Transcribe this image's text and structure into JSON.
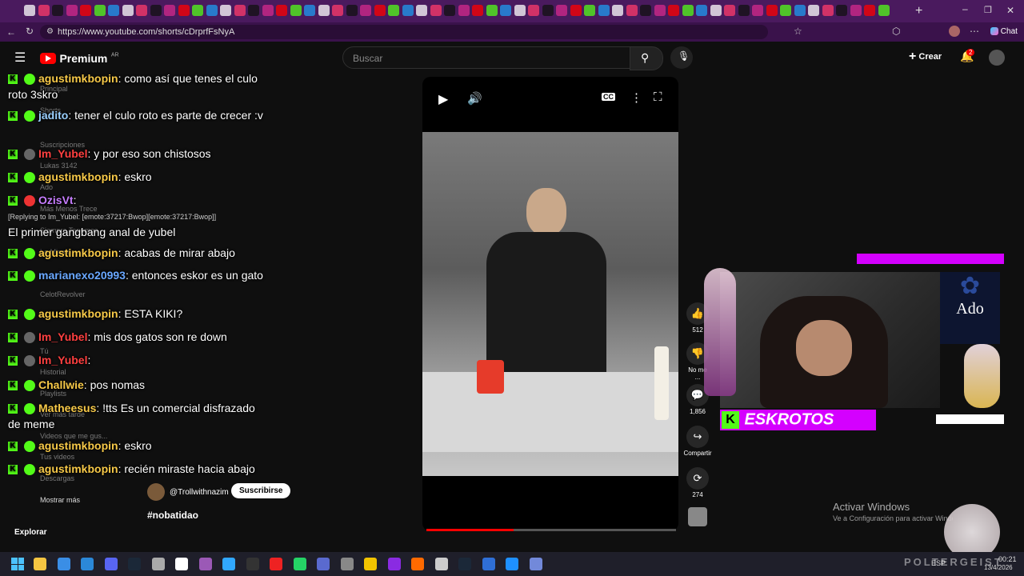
{
  "browser": {
    "url": "https://www.youtube.com/shorts/cDrprfFsNyA",
    "chat_label": "Chat"
  },
  "header": {
    "logo_text": "Premium",
    "region": "AR",
    "search_placeholder": "Buscar",
    "create_label": "Crear",
    "notif_count": "2"
  },
  "sidebar": {
    "items": [
      "Principal",
      "Shorts",
      "Suscripciones",
      "Lukas 3142",
      "Ado",
      "Más Menos Trece",
      "Siempre Tenemos",
      "Lo Mismo",
      "CelotRevolver",
      "Tú",
      "Historial",
      "Playlists",
      "Ver más tarde",
      "Videos que me gus...",
      "Tus videos",
      "Descargas",
      "Mostrar más"
    ],
    "explore_label": "Explorar"
  },
  "chat": [
    {
      "user": "agustimkbopin",
      "text": "como así que tenes el culo roto 3skro",
      "color": "g"
    },
    {
      "user": "jadito",
      "text": "tener el culo roto es parte de crecer :v",
      "color": "b"
    },
    {
      "user": "Im_Yubel",
      "text": "y por eso son chistosos",
      "color": "r"
    },
    {
      "user": "agustimkbopin",
      "text": "eskro",
      "color": "g"
    },
    {
      "user": "OzisVt",
      "text": "",
      "color": "p"
    },
    {
      "user": "",
      "text": "El primer gangbang anal de yubel",
      "color": "w"
    },
    {
      "user": "agustimkbopin",
      "text": "acabas de mirar abajo",
      "color": "g"
    },
    {
      "user": "marianexo20993",
      "text": "entonces eskor es un gato",
      "color": "lb"
    },
    {
      "user": "agustimkbopin",
      "text": "ESTA KIKI?",
      "color": "g"
    },
    {
      "user": "Im_Yubel",
      "text": "mis dos gatos son re down",
      "color": "r"
    },
    {
      "user": "Im_Yubel",
      "text": "",
      "color": "r"
    },
    {
      "user": "Challwie",
      "text": "pos nomas",
      "color": "g"
    },
    {
      "user": "Matheesus",
      "text": "!tts Es un comercial disfrazado de meme",
      "color": "g"
    },
    {
      "user": "agustimkbopin",
      "text": "eskro",
      "color": "g"
    },
    {
      "user": "agustimkbopin",
      "text": "recién miraste hacia abajo",
      "color": "g"
    }
  ],
  "reply_note": "[Replying to Im_Yubel: [emote:37217:Bwop][emote:37217:Bwop]]",
  "short": {
    "channel": "@Trollwithnazim",
    "subscribe_label": "Suscribirse",
    "hashtag": "#nobatidao",
    "likes": "512",
    "dislike_label": "No me ...",
    "comments": "1,856",
    "share_label": "Compartir",
    "remix_count": "274"
  },
  "overlay": {
    "stream_name": "ESKROTOS",
    "ado_label": "Ado"
  },
  "windows": {
    "activate_title": "Activar Windows",
    "activate_sub": "Ve a Configuración para activar Windows.",
    "lang": "ESP",
    "time": "00:21",
    "date": "13/4/2026",
    "watermark": "POLTERGEIST"
  },
  "colors": {
    "kick_green": "#53fc18",
    "magenta": "#d400ff",
    "yt_red": "#ff0000"
  }
}
